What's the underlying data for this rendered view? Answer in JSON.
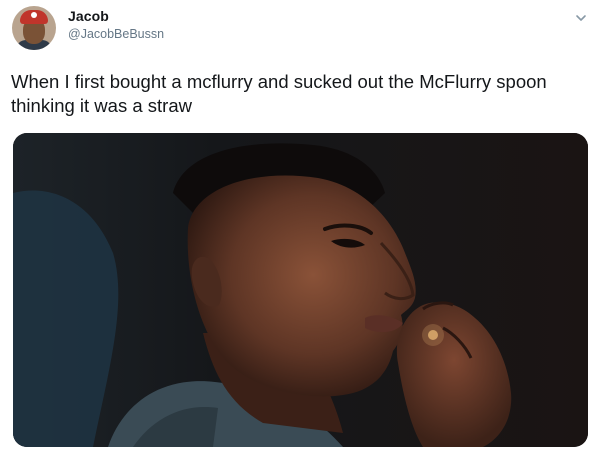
{
  "tweet": {
    "display_name": "Jacob",
    "handle": "@JacobBeBussn",
    "text": "When I first bought a mcflurry and sucked out the McFlurry spoon thinking it was a straw",
    "menu_icon": "chevron-down-icon",
    "media_icon": "photo-media"
  },
  "colors": {
    "text": "#14171a",
    "secondary_text": "#657786",
    "background": "#ffffff"
  }
}
